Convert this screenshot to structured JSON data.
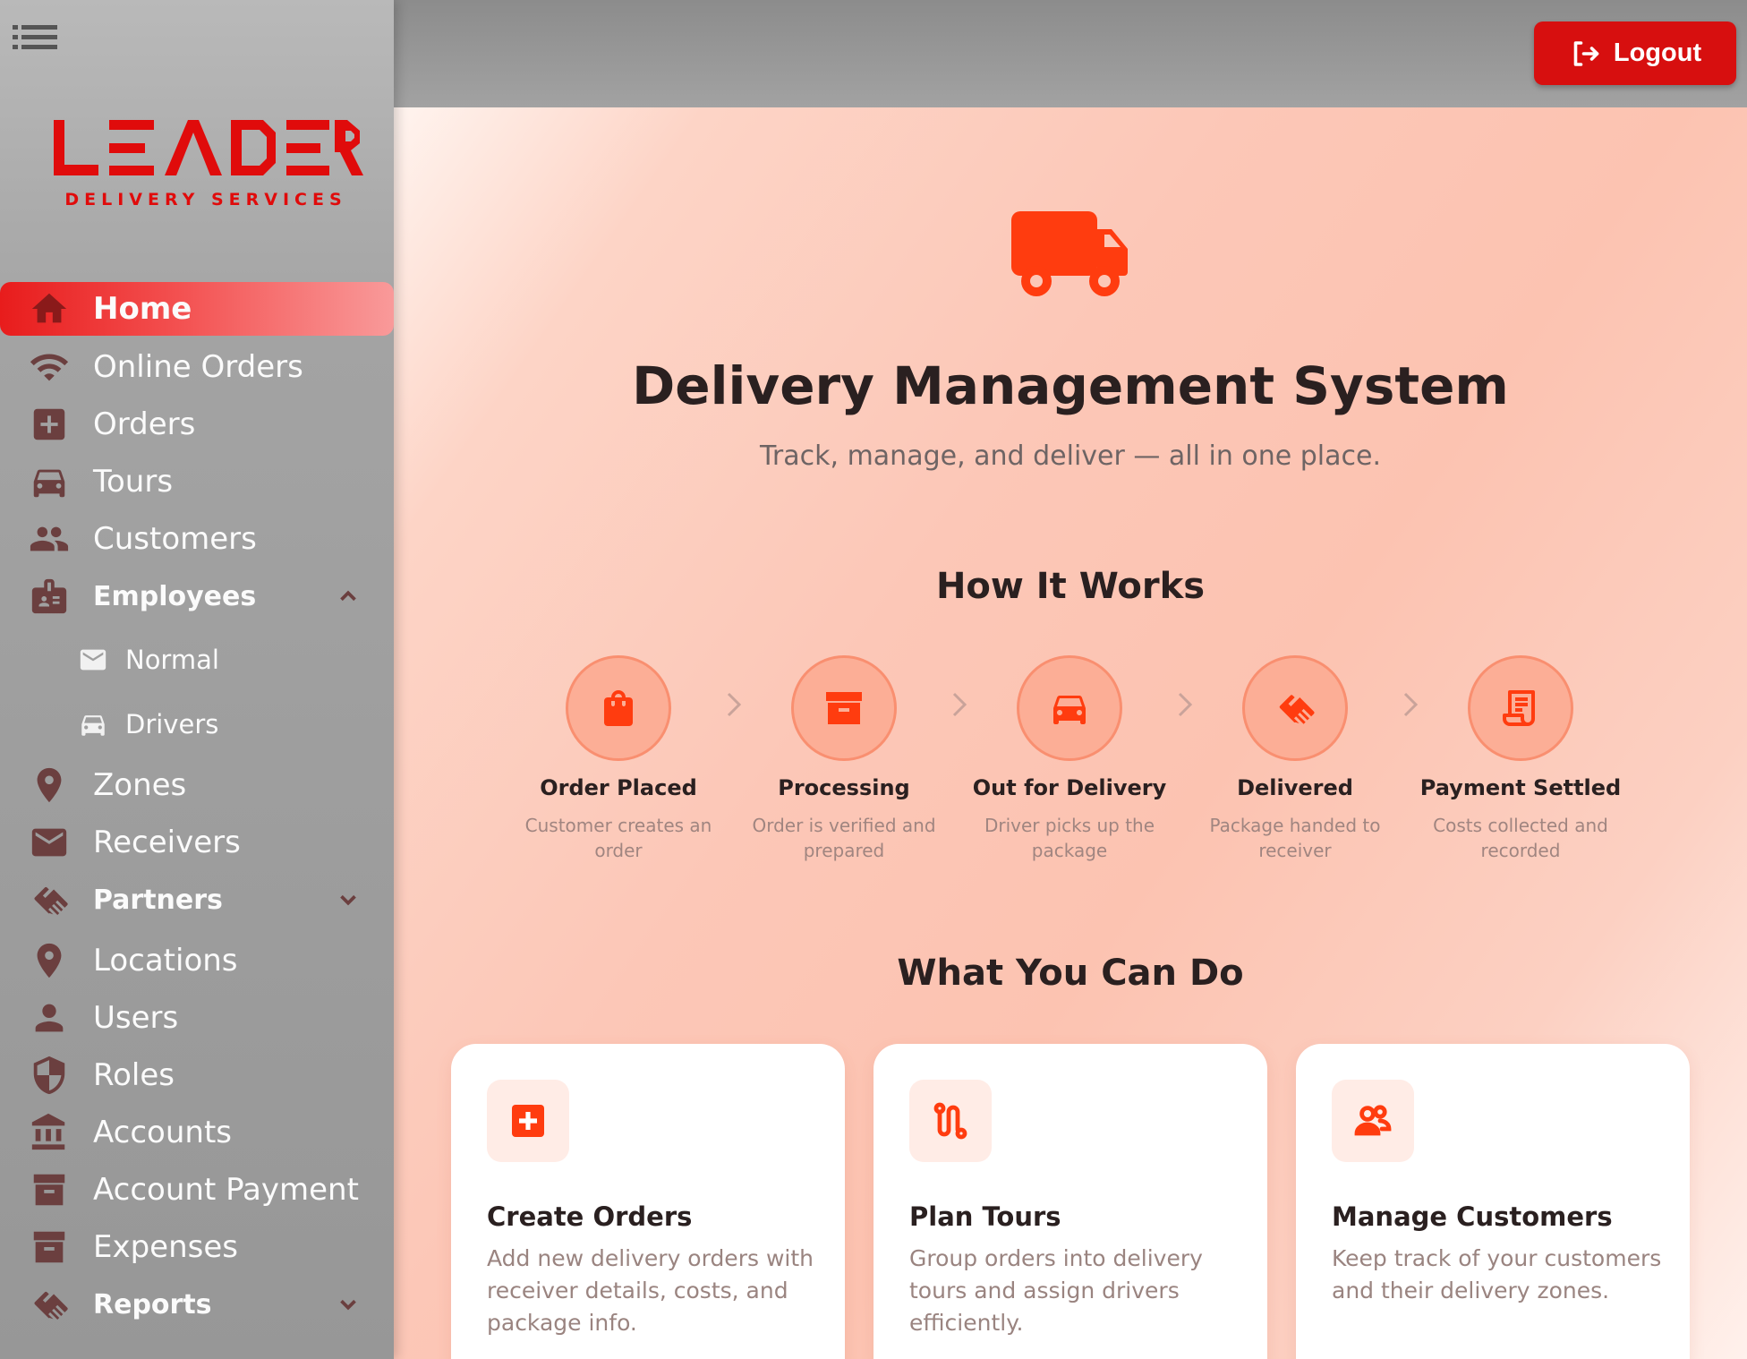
{
  "sidebar": {
    "menu_icon": "hamburger-menu-icon",
    "logo": {
      "title": "LEADER",
      "subtitle": "DELIVERY SERVICES",
      "color": "#e00b0b"
    },
    "items": [
      {
        "label": "Home",
        "icon": "home-icon",
        "active": true
      },
      {
        "label": "Online Orders",
        "icon": "wifi-icon"
      },
      {
        "label": "Orders",
        "icon": "plus-box-icon"
      },
      {
        "label": "Tours",
        "icon": "car-icon"
      },
      {
        "label": "Customers",
        "icon": "people-icon"
      },
      {
        "label": "Employees",
        "icon": "badge-icon",
        "expanded": true,
        "children": [
          {
            "label": "Normal",
            "icon": "mail-icon"
          },
          {
            "label": "Drivers",
            "icon": "car-icon"
          }
        ]
      },
      {
        "label": "Zones",
        "icon": "location-pin-icon"
      },
      {
        "label": "Receivers",
        "icon": "mail-icon"
      },
      {
        "label": "Partners",
        "icon": "handshake-icon",
        "expanded": false
      },
      {
        "label": "Locations",
        "icon": "location-pin-icon"
      },
      {
        "label": "Users",
        "icon": "person-icon"
      },
      {
        "label": "Roles",
        "icon": "shield-icon"
      },
      {
        "label": "Accounts",
        "icon": "bank-icon"
      },
      {
        "label": "Account Payment",
        "icon": "archive-icon"
      },
      {
        "label": "Expenses",
        "icon": "archive-icon"
      },
      {
        "label": "Reports",
        "icon": "handshake-icon",
        "expanded": false
      }
    ]
  },
  "topbar": {
    "logout_label": "Logout",
    "logout_color": "#d70f0f"
  },
  "hero": {
    "icon": "truck-icon",
    "title": "Delivery Management System",
    "subtitle": "Track, manage, and deliver — all in one place."
  },
  "how_it_works": {
    "heading": "How It Works",
    "steps": [
      {
        "title": "Order Placed",
        "desc": "Customer creates an order",
        "icon": "shopping-bag-icon"
      },
      {
        "title": "Processing",
        "desc": "Order is verified and prepared",
        "icon": "archive-box-icon"
      },
      {
        "title": "Out for Delivery",
        "desc": "Driver picks up the package",
        "icon": "car-icon"
      },
      {
        "title": "Delivered",
        "desc": "Package handed to receiver",
        "icon": "handshake-icon"
      },
      {
        "title": "Payment Settled",
        "desc": "Costs collected and recorded",
        "icon": "receipt-icon"
      }
    ]
  },
  "features": {
    "heading": "What You Can Do",
    "cards": [
      {
        "title": "Create Orders",
        "desc": "Add new delivery orders with receiver details, costs, and package info.",
        "icon": "plus-square-icon"
      },
      {
        "title": "Plan Tours",
        "desc": "Group orders into delivery tours and assign drivers efficiently.",
        "icon": "route-icon"
      },
      {
        "title": "Manage Customers",
        "desc": "Keep track of your customers and their delivery zones.",
        "icon": "people-icon"
      }
    ]
  },
  "colors": {
    "accent": "#ff3c0f",
    "brand_red": "#e00b0b"
  }
}
